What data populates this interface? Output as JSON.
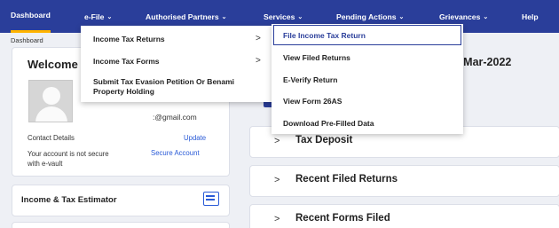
{
  "nav": {
    "dashboard": "Dashboard",
    "efile": "e-File",
    "partners": "Authorised Partners",
    "services": "Services",
    "pending": "Pending Actions",
    "grievances": "Grievances",
    "help": "Help",
    "chevron": "⌄"
  },
  "breadcrumb": "Dashboard",
  "welcome": {
    "title": "Welcome",
    "email": ":@gmail.com",
    "contact_label": "Contact Details",
    "update": "Update",
    "vault_text": "Your account is not secure with e-vault",
    "secure": "Secure Account"
  },
  "estimator": {
    "label": "Income & Tax Estimator"
  },
  "date_text": "-Mar-2022",
  "sections": [
    "Tax Deposit",
    "Recent Filed Returns",
    "Recent Forms Filed"
  ],
  "section_chevron": ">",
  "efile_menu": {
    "items": [
      "Income Tax Returns",
      "Income Tax Forms",
      "Submit Tax Evasion Petition Or Benami Property Holding"
    ],
    "arrow": ">"
  },
  "itr_submenu": {
    "items": [
      "File Income Tax Return",
      "View Filed Returns",
      "E-Verify Return",
      "View Form 26AS",
      "Download Pre-Filled Data"
    ]
  },
  "colors": {
    "navbar": "#2a3e9a",
    "link": "#2a5bd7",
    "active_underline": "#ffb300"
  }
}
